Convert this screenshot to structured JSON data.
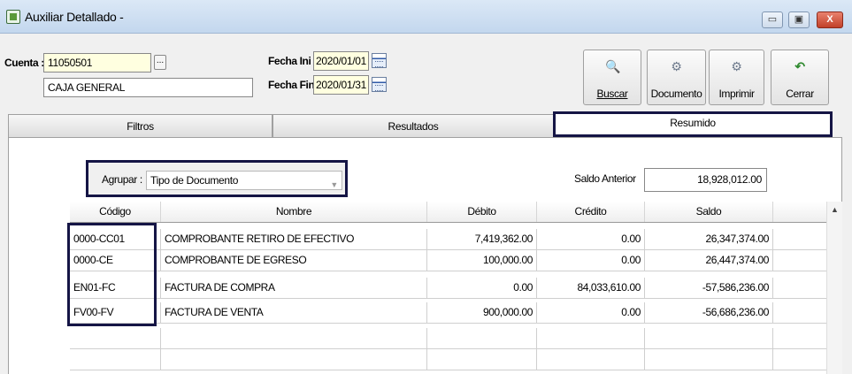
{
  "window": {
    "title": "Auxiliar Detallado -",
    "controls": {
      "minimize": "▭",
      "maximize": "▣",
      "close": "X"
    }
  },
  "form": {
    "cuenta_label": "Cuenta :",
    "cuenta_code": "11050501",
    "cuenta_name": "CAJA GENERAL",
    "browse_label": "...",
    "fecha_ini_label": "Fecha Ini :",
    "fecha_ini": "2020/01/01",
    "fecha_fin_label": "Fecha Fin :",
    "fecha_fin": "2020/01/31"
  },
  "toolbar": {
    "buscar": "Buscar",
    "documento": "Documento",
    "imprimir": "Imprimir",
    "cerrar": "Cerrar"
  },
  "tabs": {
    "filtros": "Filtros",
    "resultados": "Resultados",
    "resumido": "Resumido"
  },
  "group": {
    "label": "Agrupar :",
    "value": "Tipo de Documento"
  },
  "saldo_anterior": {
    "label": "Saldo Anterior",
    "value": "18,928,012.00"
  },
  "table": {
    "headers": {
      "codigo": "Código",
      "nombre": "Nombre",
      "debito": "Débito",
      "credito": "Crédito",
      "saldo": "Saldo"
    },
    "rows": [
      {
        "codigo": "0000-CC01",
        "nombre": "COMPROBANTE RETIRO DE EFECTIVO",
        "debito": "7,419,362.00",
        "credito": "0.00",
        "saldo": "26,347,374.00"
      },
      {
        "codigo": "0000-CE",
        "nombre": "COMPROBANTE DE EGRESO",
        "debito": "100,000.00",
        "credito": "0.00",
        "saldo": "26,447,374.00"
      },
      {
        "codigo": "EN01-FC",
        "nombre": "FACTURA DE COMPRA",
        "debito": "0.00",
        "credito": "84,033,610.00",
        "saldo": "-57,586,236.00"
      },
      {
        "codigo": "FV00-FV",
        "nombre": "FACTURA DE VENTA",
        "debito": "900,000.00",
        "credito": "0.00",
        "saldo": "-56,686,236.00"
      }
    ]
  }
}
